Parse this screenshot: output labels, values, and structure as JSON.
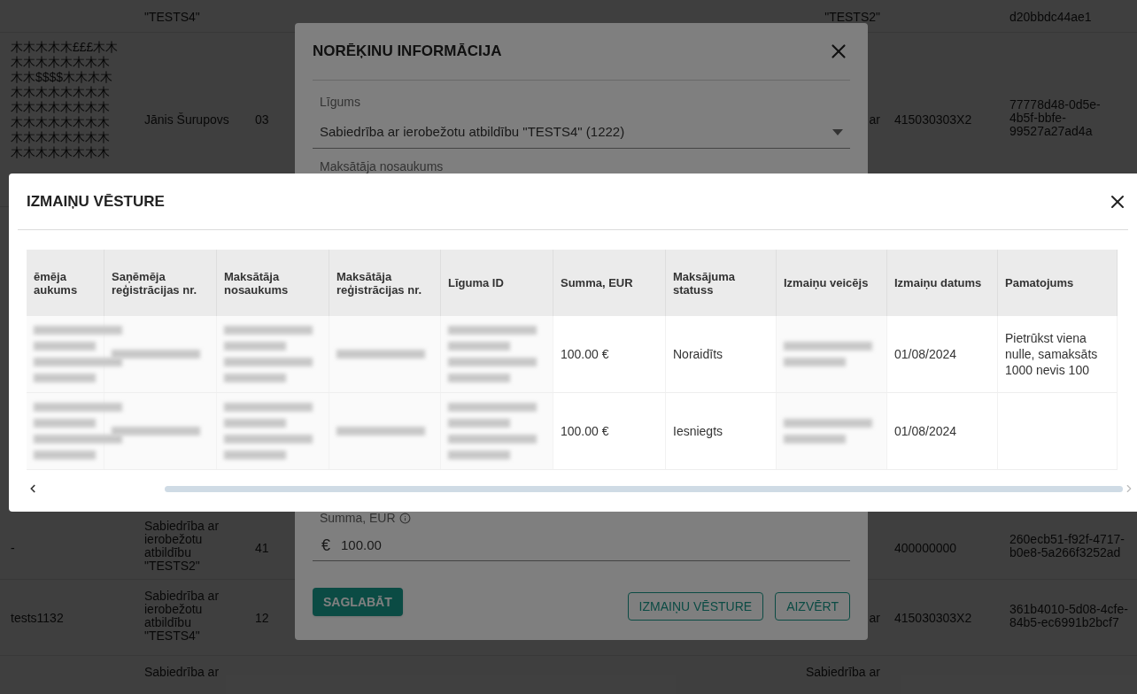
{
  "background_table": {
    "rows": [
      {
        "column_2": "\"TESTS4\"",
        "column_4": "\"TESTS2\"",
        "column_6": "d20bbdc44ae1"
      },
      {
        "column_1": [
          "木木木木木£££木木",
          "木木木木木木木木",
          "木木$$$$木木木木",
          "木木木木木木木木",
          "木木木木木木木木",
          "木木木木木木木木",
          "木木木木木木木木",
          "木木木木木木木木"
        ],
        "column_2": "Jānis Šurupovs",
        "column_3": "03",
        "column_4": "ar",
        "column_5": "415030303X2",
        "column_6": "77778d48-0d5e-4b5f-bbfe-99527a27ad4a"
      },
      {
        "column_1": "-",
        "column_2": "Sabiedrība ar ierobežotu atbildību \"TESTS2\"",
        "column_3": "41",
        "column_5": "400000000",
        "column_6": "260ecb51-f92f-4717-b0e8-5a266f3252ad"
      },
      {
        "column_1": "tests1132",
        "column_2": "Sabiedrība ar ierobežotu atbildību \"TESTS4\"",
        "column_3": "12",
        "column_4": "ar",
        "column_5": "415030303X2",
        "column_6": "361b4010-5d08-4cfe-84b5-ec6991b2bcf7"
      },
      {
        "column_2": "Sabiedrība ar",
        "column_4": "Sabiedrība ar"
      }
    ]
  },
  "invoice_dialog": {
    "title": "NORĒĶINU INFORMĀCIJA",
    "contract": {
      "label": "Līgums",
      "value": "Sabiedrība ar ierobežotu atbildību \"TESTS4\" (1222)"
    },
    "payer_label": "Maksātāja nosaukums",
    "amount": {
      "label": "Summa, EUR",
      "currency": "€",
      "value": "100.00"
    },
    "save_button": "SAGLABĀT",
    "history_button": "IZMAIŅU VĒSTURE",
    "close_button": "AIZVĒRT"
  },
  "history_dialog": {
    "title": "IZMAIŅU VĒSTURE",
    "columns": [
      "ēmēja aukums",
      "Saņēmēja reģistrācijas nr.",
      "Maksātāja nosaukums",
      "Maksātāja reģistrācijas nr.",
      "Līguma ID",
      "Summa, EUR",
      "Maksājuma statuss",
      "Izmaiņu veicējs",
      "Izmaiņu datums",
      "Pamatojums"
    ],
    "rows": [
      {
        "cells": [
          {
            "kind": "blur_four"
          },
          {
            "kind": "blur_one"
          },
          {
            "kind": "blur_four"
          },
          {
            "kind": "blur_one"
          },
          {
            "kind": "blur_four"
          },
          {
            "kind": "text",
            "text": "100.00 €"
          },
          {
            "kind": "text",
            "text": "Noraidīts"
          },
          {
            "kind": "blur_two"
          },
          {
            "kind": "text",
            "text": "01/08/2024"
          },
          {
            "kind": "text",
            "text": "Pietrūkst viena nulle, samaksāts 1000 nevis 100"
          }
        ]
      },
      {
        "cells": [
          {
            "kind": "blur_four"
          },
          {
            "kind": "blur_one"
          },
          {
            "kind": "blur_four"
          },
          {
            "kind": "blur_one"
          },
          {
            "kind": "blur_four"
          },
          {
            "kind": "text",
            "text": "100.00 €"
          },
          {
            "kind": "text",
            "text": "Iesniegts"
          },
          {
            "kind": "blur_two"
          },
          {
            "kind": "text",
            "text": "01/08/2024"
          },
          {
            "kind": "empty"
          }
        ]
      }
    ]
  }
}
